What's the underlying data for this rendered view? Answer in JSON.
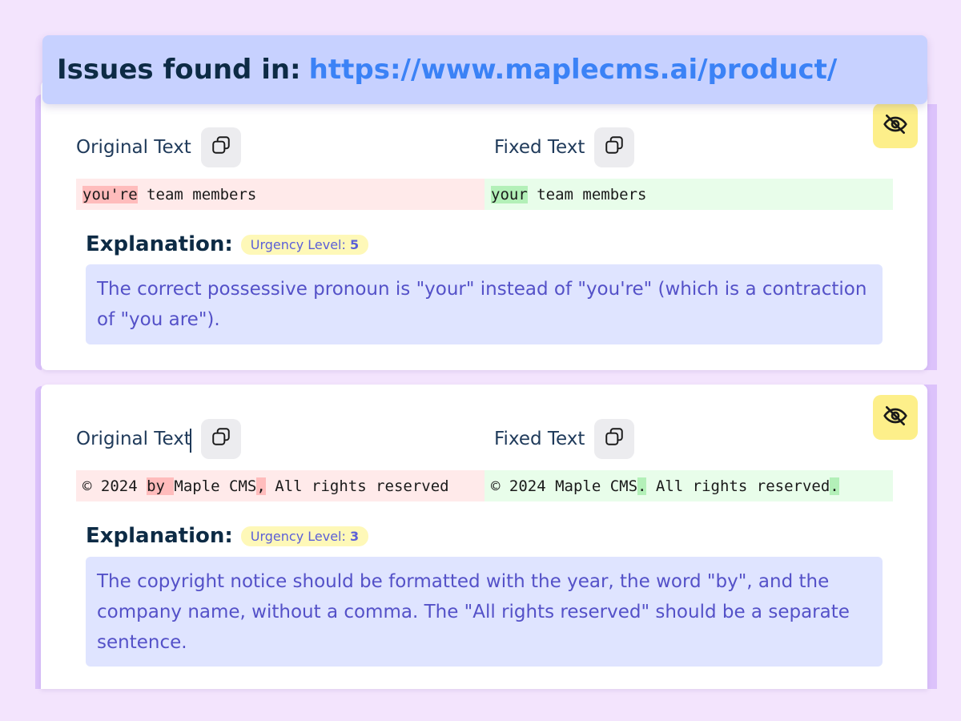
{
  "header": {
    "prefix": "Issues found in:",
    "url": "https://www.maplecms.ai/product/"
  },
  "issues": [
    {
      "original_label": "Original Text",
      "fixed_label": "Fixed Text",
      "original": {
        "removed": "you're",
        "rest": " team members"
      },
      "fixed": {
        "added": "your",
        "rest": " team members"
      },
      "explanation_label": "Explanation:",
      "urgency_label": "Urgency Level:",
      "urgency_value": "5",
      "explanation": "The correct possessive pronoun is \"your\" instead of \"you're\" (which is a contraction of \"you are\")."
    },
    {
      "original_label": "Original Text",
      "fixed_label": "Fixed Text",
      "original": {
        "p1": "© 2024 ",
        "removed1": "by ",
        "p2": "Maple CMS",
        "removed2": ",",
        "p3": " All rights reserved"
      },
      "fixed": {
        "p1": "© 2024 Maple CMS",
        "added1": ".",
        "p2": " All rights reserved",
        "added2": "."
      },
      "explanation_label": "Explanation:",
      "urgency_label": "Urgency Level:",
      "urgency_value": "3",
      "explanation": "The copyright notice should be formatted with the year, the word \"by\", and the company name, without a comma. The \"All rights reserved\" should be a separate sentence."
    }
  ],
  "icons": {
    "hide": "eye-off-icon",
    "copy": "copy-icon"
  },
  "colors": {
    "background": "#f3e4fd",
    "header_bg": "#c7d1ff",
    "url": "#3b82f6",
    "removed_highlight": "#ffbcbc",
    "added_highlight": "#b3f0b8",
    "explanation_bg": "#dfe4ff",
    "hide_button": "#fdef8a"
  }
}
